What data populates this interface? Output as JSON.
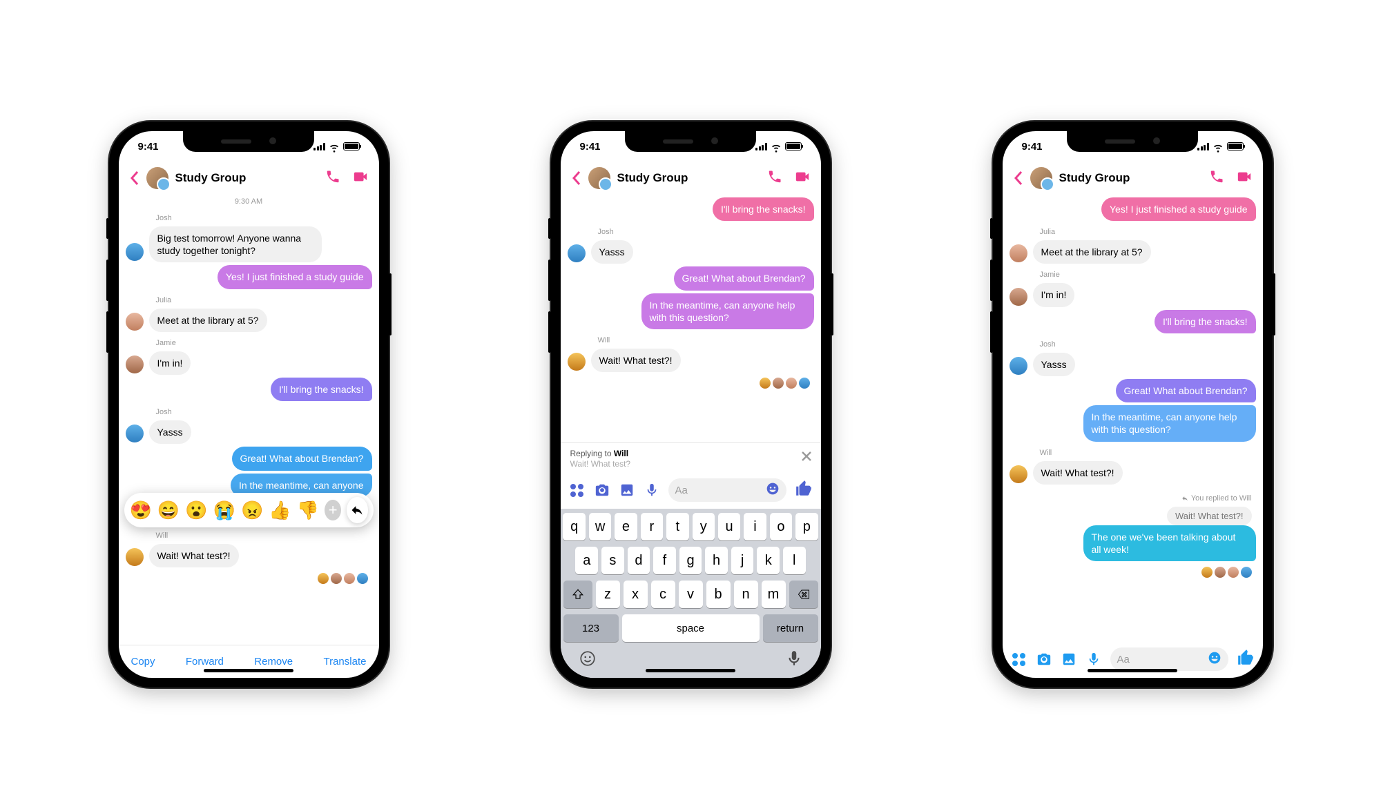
{
  "status": {
    "time": "9:41"
  },
  "header": {
    "title": "Study Group"
  },
  "p1": {
    "timestamp": "9:30 AM",
    "josh1_name": "Josh",
    "josh1": "Big test tomorrow! Anyone wanna study together tonight?",
    "me1": "Yes! I just finished a study guide",
    "julia_name": "Julia",
    "julia1": "Meet at the library at 5?",
    "jamie_name": "Jamie",
    "jamie1": "I'm in!",
    "me2": "I'll bring the snacks!",
    "josh2_name": "Josh",
    "josh2": "Yasss",
    "me3": "Great! What about Brendan?",
    "me4": "In the meantime, can anyone",
    "will_name": "Will",
    "will1": "Wait! What test?!",
    "reactions": {
      "e1": "😍",
      "e2": "😄",
      "e3": "😮",
      "e4": "😭",
      "e5": "😠",
      "e6": "👍",
      "e7": "👎"
    },
    "menu": {
      "copy": "Copy",
      "forward": "Forward",
      "remove": "Remove",
      "translate": "Translate"
    }
  },
  "p2": {
    "me0": "I'll bring the snacks!",
    "josh_name": "Josh",
    "josh1": "Yasss",
    "me1": "Great! What about Brendan?",
    "me2": "In the meantime, can anyone help with this question?",
    "will_name": "Will",
    "will1": "Wait! What test?!",
    "reply": {
      "label": "Replying to ",
      "name": "Will",
      "quoted": "Wait! What test?"
    },
    "composer": {
      "placeholder": "Aa"
    },
    "keys": {
      "r1": [
        "q",
        "w",
        "e",
        "r",
        "t",
        "y",
        "u",
        "i",
        "o",
        "p"
      ],
      "r2": [
        "a",
        "s",
        "d",
        "f",
        "g",
        "h",
        "j",
        "k",
        "l"
      ],
      "r3": [
        "z",
        "x",
        "c",
        "v",
        "b",
        "n",
        "m"
      ],
      "num": "123",
      "space": "space",
      "return": "return"
    }
  },
  "p3": {
    "me0": "Yes! I just finished a study guide",
    "julia_name": "Julia",
    "julia1": "Meet at the library at 5?",
    "jamie_name": "Jamie",
    "jamie1": "I'm in!",
    "me1": "I'll bring the snacks!",
    "josh_name": "Josh",
    "josh1": "Yasss",
    "me2": "Great! What about Brendan?",
    "me3": "In the meantime, can anyone help with this question?",
    "will_name": "Will",
    "will1": "Wait! What test?!",
    "reply_ref": "You replied to Will",
    "quoted": "Wait! What test?!",
    "me4": "The one we've been talking about all week!",
    "composer": {
      "placeholder": "Aa"
    }
  }
}
